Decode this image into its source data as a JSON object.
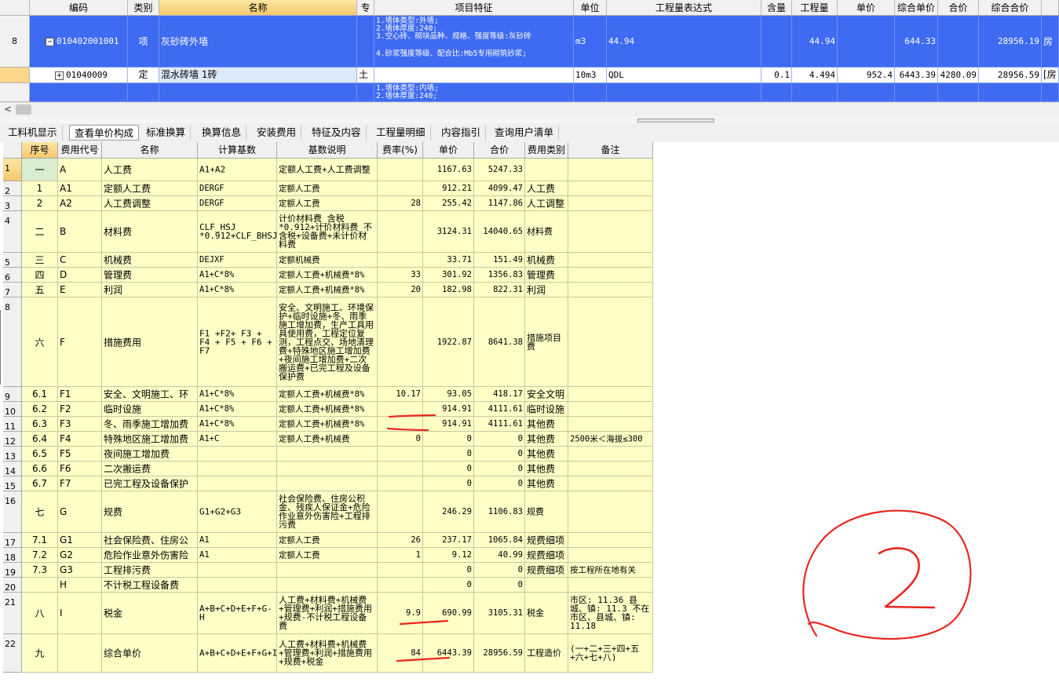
{
  "top_grid": {
    "headers": [
      "编码",
      "类别",
      "名称",
      "专",
      "项目特征",
      "单位",
      "工程量表达式",
      "含量",
      "工程量",
      "单价",
      "综合单价",
      "合价",
      "综合合价"
    ],
    "rows": [
      {
        "num": "8",
        "code": "010402001001",
        "type": "项",
        "name": "灰砂砖外墙",
        "spec": "",
        "features": [
          "1.墙体类型:外墙;",
          "2.墙体厚度:240;",
          "3.空心砖、砌块品种、规格、强度等级:灰砂砖",
          "4.砂浆强度等级、配合比:Mb5专用砌筑砂浆;"
        ],
        "unit": "m3",
        "expr": "44.94",
        "content": "",
        "qty": "44.94",
        "price": "",
        "comp_price": "644.33",
        "total": "",
        "comp_total": "28956.19",
        "extra": "房"
      },
      {
        "num": "",
        "code": "01040009",
        "type": "定",
        "name": "混水砖墙 1砖",
        "spec": "土",
        "features": [],
        "unit": "10m3",
        "expr": "QDL",
        "content": "0.1",
        "qty": "4.494",
        "price": "952.4",
        "comp_price": "6443.39",
        "total": "4280.09",
        "comp_total": "28956.59",
        "extra": "[房"
      },
      {
        "num": "",
        "code": "",
        "type": "",
        "name": "",
        "spec": "",
        "features": [
          "1.墙体类型:内墙;",
          "2.墙体厚度:240;"
        ],
        "unit": "",
        "expr": "",
        "content": "",
        "qty": "",
        "price": "",
        "comp_price": "",
        "total": "",
        "comp_total": "",
        "extra": ""
      }
    ],
    "scroll_left": "<"
  },
  "tabs": [
    "工料机显示",
    "查看单价构成",
    "标准换算",
    "换算信息",
    "安装费用",
    "特征及内容",
    "工程量明细",
    "内容指引",
    "查询用户清单"
  ],
  "active_tab": 1,
  "bottom_grid": {
    "headers": [
      "序号",
      "费用代号",
      "名称",
      "计算基数",
      "基数说明",
      "费率(%)",
      "单价",
      "合价",
      "费用类别",
      "备注"
    ],
    "rows": [
      {
        "n": "1",
        "seq": "一",
        "code": "A",
        "name": "人工费",
        "base": "A1+A2",
        "desc": "定额人工费+人工费调整",
        "rate": "",
        "price": "1167.63",
        "total": "5247.33",
        "cat": "",
        "note": ""
      },
      {
        "n": "2",
        "seq": "1",
        "code": "A1",
        "name": "定额人工费",
        "base": "DERGF",
        "desc": "定额人工费",
        "rate": "",
        "price": "912.21",
        "total": "4099.47",
        "cat": "人工费",
        "note": ""
      },
      {
        "n": "3",
        "seq": "2",
        "code": "A2",
        "name": "人工费调整",
        "base": "DERGF",
        "desc": "定额人工费",
        "rate": "28",
        "price": "255.42",
        "total": "1147.86",
        "cat": "人工调整",
        "note": ""
      },
      {
        "n": "4",
        "seq": "二",
        "code": "B",
        "name": "材料费",
        "base": "CLF_HSJ *0.912+CLF_BHSJ+SBF+ZCF",
        "desc": "计价材料费_含税*0.912+计价材料费_不含税+设备费+未计价材料费",
        "rate": "",
        "price": "3124.31",
        "total": "14040.65",
        "cat": "材料费",
        "note": ""
      },
      {
        "n": "5",
        "seq": "三",
        "code": "C",
        "name": "机械费",
        "base": "DEJXF",
        "desc": "定额机械费",
        "rate": "",
        "price": "33.71",
        "total": "151.49",
        "cat": "机械费",
        "note": ""
      },
      {
        "n": "6",
        "seq": "四",
        "code": "D",
        "name": "管理费",
        "base": "A1+C*8%",
        "desc": "定额人工费+机械费*8%",
        "rate": "33",
        "price": "301.92",
        "total": "1356.83",
        "cat": "管理费",
        "note": ""
      },
      {
        "n": "7",
        "seq": "五",
        "code": "E",
        "name": "利润",
        "base": "A1+C*8%",
        "desc": "定额人工费+机械费*8%",
        "rate": "20",
        "price": "182.98",
        "total": "822.31",
        "cat": "利润",
        "note": ""
      },
      {
        "n": "8",
        "seq": "六",
        "code": "F",
        "name": "措施费用",
        "base": "F1 +F2+ F3 + F4 + F5 + F6 + F7",
        "desc": "安全、文明施工、环境保护+临时设施+冬、雨季施工增加费，生产工具用具使用费，工程定位复测，工程点交、场地清理费+特殊地区施工增加费+夜间施工增加费+二次搬运费+已完工程及设备保护费",
        "rate": "",
        "price": "1922.87",
        "total": "8641.38",
        "cat": "措施项目费",
        "note": ""
      },
      {
        "n": "9",
        "seq": "6.1",
        "code": "F1",
        "name": "安全、文明施工、环",
        "base": "A1+C*8%",
        "desc": "定额人工费+机械费*8%",
        "rate": "10.17",
        "price": "93.05",
        "total": "418.17",
        "cat": "安全文明",
        "note": ""
      },
      {
        "n": "10",
        "seq": "6.2",
        "code": "F2",
        "name": "临时设施",
        "base": "A1+C*8%",
        "desc": "定额人工费+机械费*8%",
        "rate": "",
        "price": "914.91",
        "total": "4111.61",
        "cat": "临时设施",
        "note": ""
      },
      {
        "n": "11",
        "seq": "6.3",
        "code": "F3",
        "name": "冬、雨季施工增加费",
        "base": "A1+C*8%",
        "desc": "定额人工费+机械费*8%",
        "rate": "",
        "price": "914.91",
        "total": "4111.61",
        "cat": "其他费",
        "note": ""
      },
      {
        "n": "12",
        "seq": "6.4",
        "code": "F4",
        "name": "特殊地区施工增加费",
        "base": "A1+C",
        "desc": "定额人工费+机械费",
        "rate": "0",
        "price": "0",
        "total": "0",
        "cat": "其他费",
        "note": "2500米＜海拔≤300"
      },
      {
        "n": "13",
        "seq": "6.5",
        "code": "F5",
        "name": "夜间施工增加费",
        "base": "",
        "desc": "",
        "rate": "",
        "price": "0",
        "total": "0",
        "cat": "其他费",
        "note": ""
      },
      {
        "n": "14",
        "seq": "6.6",
        "code": "F6",
        "name": "二次搬运费",
        "base": "",
        "desc": "",
        "rate": "",
        "price": "0",
        "total": "0",
        "cat": "其他费",
        "note": ""
      },
      {
        "n": "15",
        "seq": "6.7",
        "code": "F7",
        "name": "已完工程及设备保护",
        "base": "",
        "desc": "",
        "rate": "",
        "price": "0",
        "total": "0",
        "cat": "其他费",
        "note": ""
      },
      {
        "n": "16",
        "seq": "七",
        "code": "G",
        "name": "规费",
        "base": "G1+G2+G3",
        "desc": "社会保险费、住房公积金、残疾人保证金+危险作业意外伤害险+工程排污费",
        "rate": "",
        "price": "246.29",
        "total": "1106.83",
        "cat": "规费",
        "note": ""
      },
      {
        "n": "17",
        "seq": "7.1",
        "code": "G1",
        "name": "社会保险费、住房公",
        "base": "A1",
        "desc": "定额人工费",
        "rate": "26",
        "price": "237.17",
        "total": "1065.84",
        "cat": "规费细项",
        "note": ""
      },
      {
        "n": "18",
        "seq": "7.2",
        "code": "G2",
        "name": "危险作业意外伤害险",
        "base": "A1",
        "desc": "定额人工费",
        "rate": "1",
        "price": "9.12",
        "total": "40.99",
        "cat": "规费细项",
        "note": ""
      },
      {
        "n": "19",
        "seq": "7.3",
        "code": "G3",
        "name": "工程排污费",
        "base": "",
        "desc": "",
        "rate": "",
        "price": "0",
        "total": "0",
        "cat": "规费细项",
        "note": "按工程所在地有关"
      },
      {
        "n": "20",
        "seq": "",
        "code": "H",
        "name": "不计税工程设备费",
        "base": "",
        "desc": "",
        "rate": "",
        "price": "0",
        "total": "0",
        "cat": "",
        "note": ""
      },
      {
        "n": "21",
        "seq": "八",
        "code": "I",
        "name": "税金",
        "base": "A+B+C+D+E+F+G-H",
        "desc": "人工费+材料费+机械费+管理费+利润+措施费用+规费-不计税工程设备费",
        "rate": "9.9",
        "price": "690.99",
        "total": "3105.31",
        "cat": "税金",
        "note": "市区: 11.36 县城、镇: 11.3 不在市区、县城、镇: 11.18"
      },
      {
        "n": "22",
        "seq": "九",
        "code": "",
        "name": "综合单价",
        "base": "A+B+C+D+E+F+G+I",
        "desc": "人工费+材料费+机械费+管理费+利润+措施费用+规费+税金",
        "rate": "84",
        "price": "6443.39",
        "total": "28956.59",
        "cat": "工程造价",
        "note": "(一+二+三+四+五+六+七+八)"
      }
    ]
  },
  "annotation": {
    "label": "2",
    "color": "#e8261f"
  }
}
